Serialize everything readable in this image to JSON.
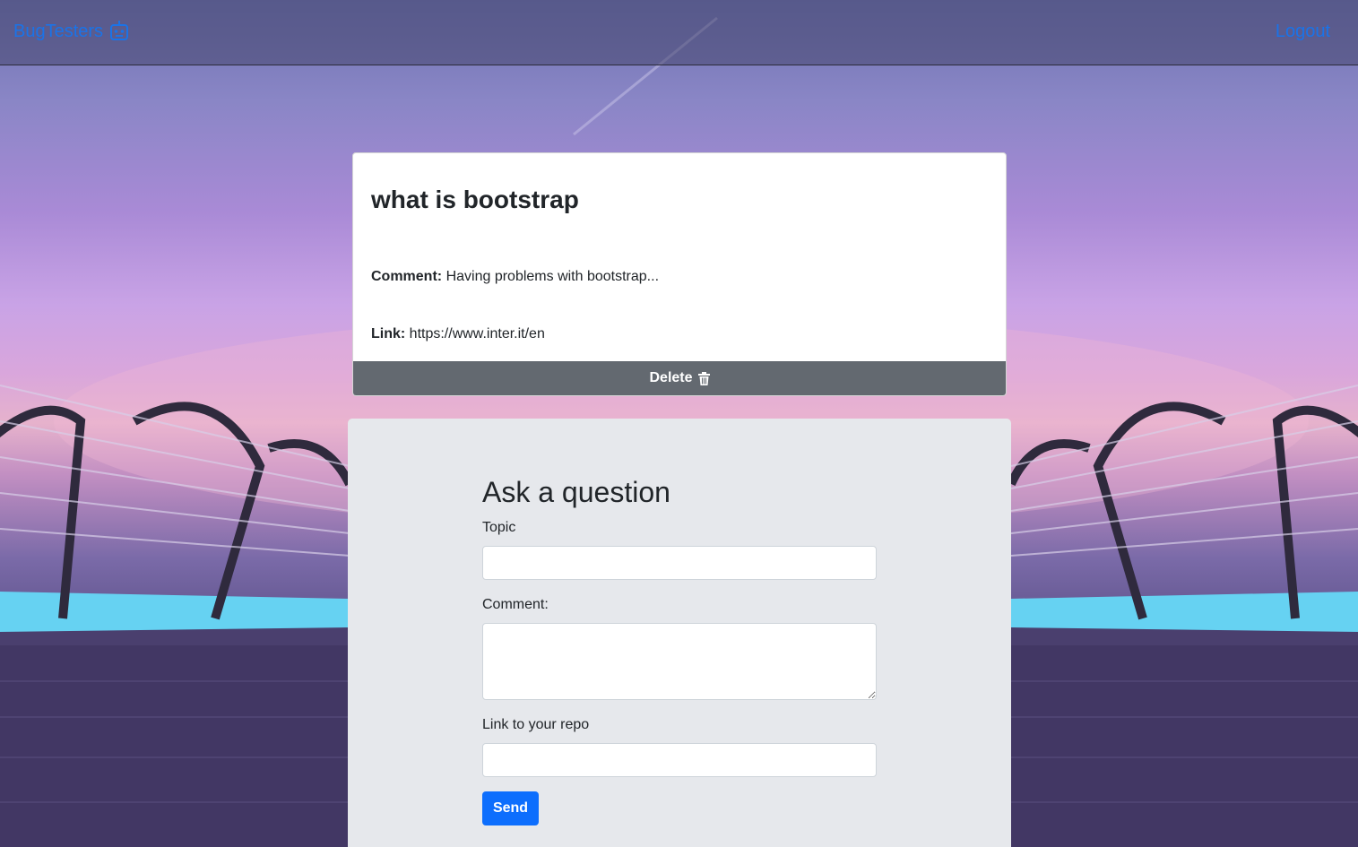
{
  "navbar": {
    "brand": "BugTesters",
    "logout": "Logout"
  },
  "question": {
    "title": "what is bootstrap",
    "comment_label": "Comment:",
    "comment": "Having problems with bootstrap...",
    "link_label": "Link:",
    "link": "https://www.inter.it/en",
    "delete_label": "Delete"
  },
  "form": {
    "title": "Ask a question",
    "topic_label": "Topic",
    "topic_value": "",
    "comment_label": "Comment:",
    "comment_value": "",
    "repo_label": "Link to your repo",
    "repo_value": "",
    "send_label": "Send"
  },
  "colors": {
    "link_blue": "#1a73e8",
    "delete_gray": "#636970",
    "send_blue": "#0d6efd",
    "panel_bg": "#e6e8ec"
  },
  "icons": {
    "brand_icon": "robot-icon",
    "delete_icon": "trash-icon"
  }
}
